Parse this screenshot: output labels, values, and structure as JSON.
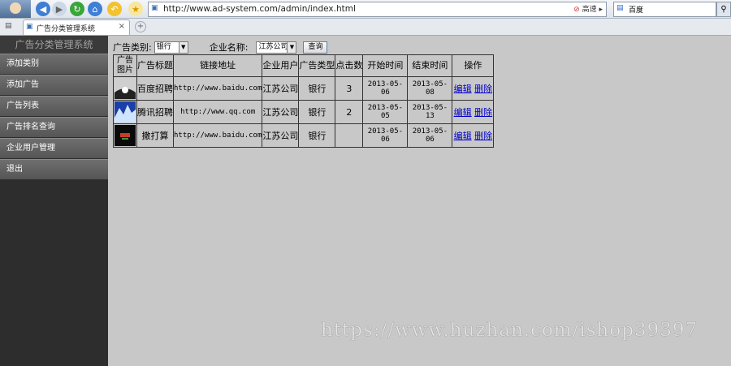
{
  "browser": {
    "url": "http://www.ad-system.com/admin/index.html",
    "address_tools": "高速",
    "search_value": "百度",
    "tab_title": "广告分类管理系统",
    "tab_close": "×",
    "new_tab": "+"
  },
  "sidebar": {
    "title": "广告分类管理系统",
    "items": [
      {
        "label": "添加类别"
      },
      {
        "label": "添加广告"
      },
      {
        "label": "广告列表"
      },
      {
        "label": "广告排名查询"
      },
      {
        "label": "企业用户管理"
      },
      {
        "label": "退出"
      }
    ]
  },
  "filter": {
    "category_label": "广告类别:",
    "category_value": "银行",
    "company_label": "企业名称:",
    "company_value": "江苏公司",
    "query_button": "查询"
  },
  "table": {
    "headers": [
      "广告图片",
      "广告标题",
      "链接地址",
      "企业用户",
      "广告类型",
      "点击数",
      "开始时间",
      "结束时间",
      "操作"
    ],
    "rows": [
      {
        "title": "百度招聘",
        "url": "http://www.baidu.com",
        "company": "江苏公司",
        "type": "银行",
        "clicks": "3",
        "start": "2013-05-06",
        "end": "2013-05-08",
        "edit": "编辑",
        "delete": "删除"
      },
      {
        "title": "腾讯招聘",
        "url": "http://www.qq.com",
        "company": "江苏公司",
        "type": "银行",
        "clicks": "2",
        "start": "2013-05-05",
        "end": "2013-05-13",
        "edit": "编辑",
        "delete": "删除"
      },
      {
        "title": "撒打算",
        "url": "http://www.baidu.com",
        "company": "江苏公司",
        "type": "银行",
        "clicks": "",
        "start": "2013-05-06",
        "end": "2013-05-06",
        "edit": "编辑",
        "delete": "删除"
      }
    ]
  },
  "watermark": "https://www.huzhan.com/ishop39397"
}
